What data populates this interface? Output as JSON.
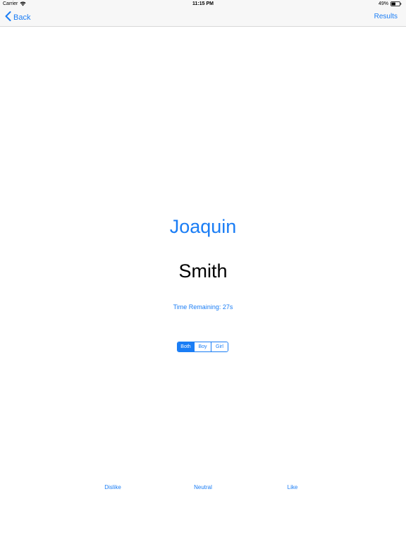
{
  "status_bar": {
    "carrier": "Carrier",
    "time": "11:15 PM",
    "battery_percent": "49%"
  },
  "nav": {
    "back_label": "Back",
    "results_label": "Results"
  },
  "main": {
    "first_name": "Joaquin",
    "last_name": "Smith",
    "timer_text": "Time Remaining: 27s"
  },
  "gender_filter": {
    "options": [
      "Both",
      "Boy",
      "Girl"
    ],
    "selected": "Both"
  },
  "actions": {
    "dislike": "Dislike",
    "neutral": "Neutral",
    "like": "Like"
  },
  "colors": {
    "accent": "#1a7df5",
    "bar_background": "#f7f7f7"
  }
}
